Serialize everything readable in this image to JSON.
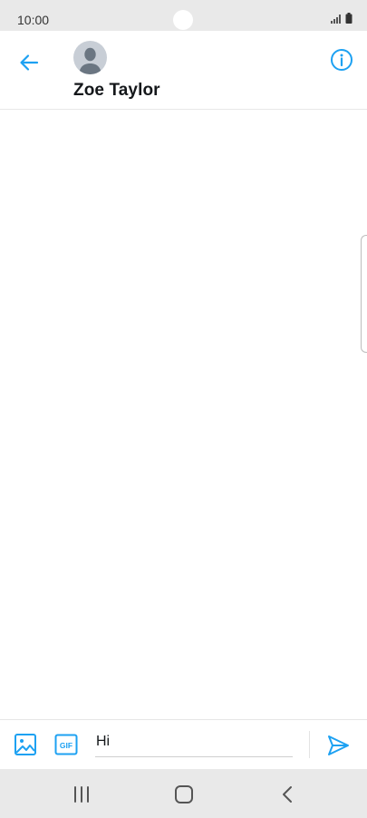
{
  "status_bar": {
    "time": "10:00"
  },
  "header": {
    "contact_name": "Zoe Taylor"
  },
  "composer": {
    "message_value": "Hi",
    "gif_label": "GIF"
  },
  "colors": {
    "accent": "#1da1f2",
    "text": "#14171a",
    "avatar_bg": "#c8ced6",
    "avatar_fg": "#6b7682"
  },
  "icons": {
    "back": "arrow-left-icon",
    "info": "info-icon",
    "media": "image-icon",
    "gif": "gif-icon",
    "send": "send-icon"
  }
}
